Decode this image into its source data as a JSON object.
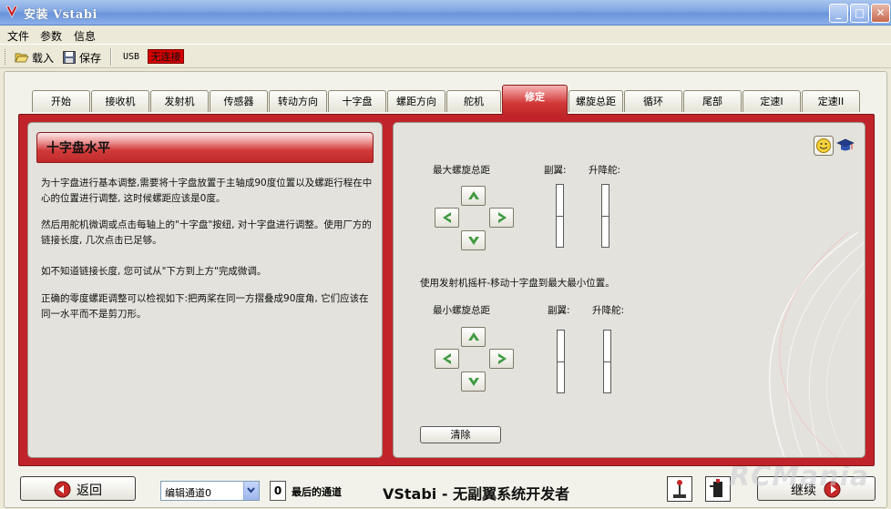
{
  "window": {
    "title": "安装 Vstabi"
  },
  "menu": {
    "items": [
      "文件",
      "参数",
      "信息"
    ]
  },
  "toolbar": {
    "load_label": "载入",
    "save_label": "保存",
    "usb_label": "USB",
    "connection_status": "无连接"
  },
  "tabs": [
    "开始",
    "接收机",
    "发射机",
    "传感器",
    "转动方向",
    "十字盘",
    "螺距方向",
    "舵机",
    "修定",
    "螺旋总距",
    "循环",
    "尾部",
    "定速I",
    "定速II"
  ],
  "active_tab": "修定",
  "left_panel": {
    "heading": "十字盘水平",
    "paragraphs": [
      "为十字盘进行基本调整,需要将十字盘放置于主轴成90度位置以及螺距行程在中心的位置进行调整, 这时候螺距应该是0度。",
      "然后用舵机微调或点击每轴上的\"十字盘\"按纽, 对十字盘进行调整。使用厂方的链接长度, 几次点击已足够。",
      "如不知道链接长度, 您可试从\"下方到上方\"完成微调。",
      "正确的零度螺距调整可以检视如下:把两桨在同一方摺叠成90度角, 它们应该在同一水平而不是剪刀形。"
    ]
  },
  "right_panel": {
    "max_pitch_label": "最大螺旋总距",
    "aileron_label": "副翼:",
    "elevator_label": "升降舵:",
    "instruction": "使用发射机摇杆-移动十字盘到最大最小位置。",
    "min_pitch_label": "最小螺旋总距",
    "aileron_label_2": "副翼:",
    "elevator_label_2": "升降舵:",
    "clear_label": "清除",
    "icons": [
      "smiley-icon",
      "graduation-cap-icon"
    ]
  },
  "bottom": {
    "back_label": "返回",
    "edit_channel_value": "编辑通道0",
    "channel_number": "0",
    "channel_label": "最后的通道",
    "brand": "VStabi - 无副翼系统开发者",
    "next_label": "继续",
    "watermark": "RCMania"
  },
  "colors": {
    "accent_red": "#c0242a",
    "titlebar_blue": "#7fa6e3",
    "arrow_green": "#3f9a3f"
  }
}
